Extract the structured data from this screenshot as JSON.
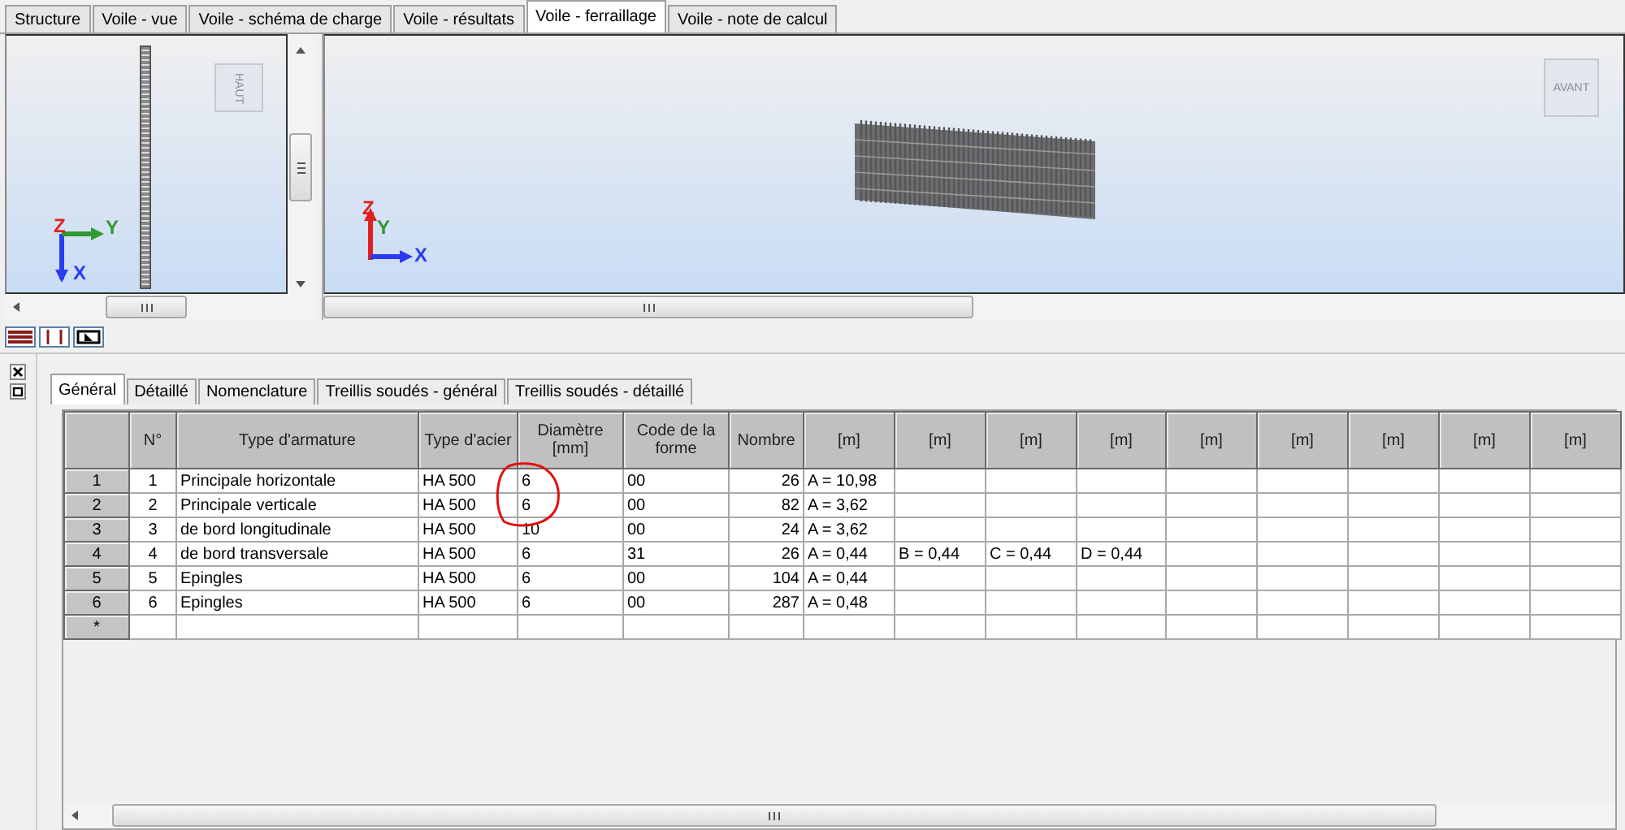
{
  "tabs": [
    {
      "label": "Structure",
      "selected": false
    },
    {
      "label": "Voile - vue",
      "selected": false
    },
    {
      "label": "Voile - schéma de charge",
      "selected": false
    },
    {
      "label": "Voile - résultats",
      "selected": false
    },
    {
      "label": "Voile - ferraillage",
      "selected": true
    },
    {
      "label": "Voile - note de calcul",
      "selected": false
    }
  ],
  "left_view": {
    "nav_cube": "HAUT",
    "axes": {
      "z": "Z",
      "y": "Y",
      "x": "X"
    }
  },
  "main_view": {
    "nav_cube": "AVANT",
    "axes": {
      "z": "Z",
      "y": "Y",
      "x": "X"
    }
  },
  "table_tabs": [
    {
      "label": "Général",
      "selected": true
    },
    {
      "label": "Détaillé",
      "selected": false
    },
    {
      "label": "Nomenclature",
      "selected": false
    },
    {
      "label": "Treillis soudés - général",
      "selected": false
    },
    {
      "label": "Treillis soudés - détaillé",
      "selected": false
    }
  ],
  "table": {
    "columns": [
      "N°",
      "Type d'armature",
      "Type d'acier",
      "Diamètre [mm]",
      "Code de la forme",
      "Nombre",
      "[m]",
      "[m]",
      "[m]",
      "[m]",
      "[m]",
      "[m]",
      "[m]",
      "[m]",
      "[m]"
    ],
    "rows": [
      {
        "header": "1",
        "cells": [
          "1",
          "Principale horizontale",
          "HA 500",
          "6",
          "00",
          "26",
          "A = 10,98",
          "",
          "",
          "",
          "",
          "",
          "",
          "",
          ""
        ]
      },
      {
        "header": "2",
        "cells": [
          "2",
          "Principale verticale",
          "HA 500",
          "6",
          "00",
          "82",
          "A = 3,62",
          "",
          "",
          "",
          "",
          "",
          "",
          "",
          ""
        ]
      },
      {
        "header": "3",
        "cells": [
          "3",
          "de bord longitudinale",
          "HA 500",
          "10",
          "00",
          "24",
          "A = 3,62",
          "",
          "",
          "",
          "",
          "",
          "",
          "",
          ""
        ]
      },
      {
        "header": "4",
        "cells": [
          "4",
          "de bord transversale",
          "HA 500",
          "6",
          "31",
          "26",
          "A = 0,44",
          "B = 0,44",
          "C = 0,44",
          "D = 0,44",
          "",
          "",
          "",
          "",
          ""
        ]
      },
      {
        "header": "5",
        "cells": [
          "5",
          "Epingles",
          "HA 500",
          "6",
          "00",
          "104",
          "A = 0,44",
          "",
          "",
          "",
          "",
          "",
          "",
          "",
          ""
        ]
      },
      {
        "header": "6",
        "cells": [
          "6",
          "Epingles",
          "HA 500",
          "6",
          "00",
          "287",
          "A = 0,48",
          "",
          "",
          "",
          "",
          "",
          "",
          "",
          ""
        ]
      }
    ],
    "new_row_header": "*"
  }
}
